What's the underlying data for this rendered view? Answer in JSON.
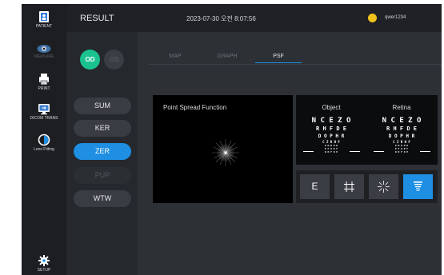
{
  "nav": {
    "items": [
      {
        "label": "PATIENT",
        "icon": "patient-icon"
      },
      {
        "label": "MEASURE",
        "icon": "eye-icon"
      },
      {
        "label": "PRINT",
        "icon": "printer-icon"
      },
      {
        "label": "DICOM TRANS",
        "icon": "monitor-transfer-icon"
      },
      {
        "label": "Lens Fitting",
        "icon": "lens-fitting-icon"
      },
      {
        "label": "SETUP",
        "icon": "gear-icon"
      }
    ]
  },
  "header": {
    "title": "RESULT",
    "datetime": "2023-07-30 오전 8:07:56",
    "user": "qwer1234"
  },
  "eye_select": {
    "od": "OD",
    "os": "OS",
    "selected": "OD"
  },
  "modes": [
    {
      "label": "SUM",
      "state": "normal"
    },
    {
      "label": "KER",
      "state": "normal"
    },
    {
      "label": "ZER",
      "state": "active"
    },
    {
      "label": "PUP",
      "state": "disabled"
    },
    {
      "label": "WTW",
      "state": "normal"
    }
  ],
  "tabs": [
    {
      "label": "MAP",
      "active": false
    },
    {
      "label": "GRAPH",
      "active": false
    },
    {
      "label": "PSF",
      "active": true
    }
  ],
  "psf": {
    "title": "Point Spread Function"
  },
  "chart": {
    "object_label": "Object",
    "retina_label": "Retina",
    "rows": [
      "N C E Z O",
      "R H F D E",
      "D O P H R",
      "C Z R H F",
      "O N R H D",
      "E F Z R F",
      "R H F D E"
    ]
  },
  "controls": [
    {
      "label": "E",
      "icon": "letter-e-icon",
      "active": false
    },
    {
      "label": "",
      "icon": "grid-icon",
      "active": false
    },
    {
      "label": "",
      "icon": "starburst-icon",
      "active": false
    },
    {
      "label": "",
      "icon": "eye-chart-icon",
      "active": true
    }
  ],
  "colors": {
    "accent": "#1e8fe3",
    "od": "#1ac28f",
    "user": "#f1c21b"
  }
}
